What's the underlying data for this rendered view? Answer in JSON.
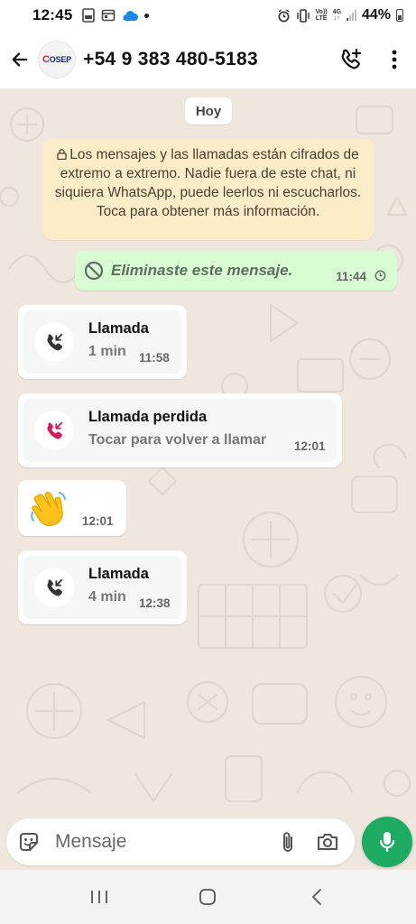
{
  "status_bar": {
    "time": "12:45",
    "network_volte": "Vo))",
    "network_lte": "LTE",
    "network_4g": "4G",
    "battery": "44%"
  },
  "header": {
    "avatar_text": "COSEP",
    "contact": "+54 9 383 480-5183",
    "icons": [
      "back-arrow-icon",
      "add-call-icon",
      "more-vert-icon"
    ]
  },
  "chat": {
    "date_chip": "Hoy",
    "e2e_notice": "Los mensajes y las llamadas están cifrados de extremo a extremo. Nadie fuera de este chat, ni siquiera WhatsApp, puede leerlos ni escucharlos. Toca para obtener más información.",
    "deleted": {
      "text": "Eliminaste este mensaje.",
      "time": "11:44"
    },
    "calls": [
      {
        "title": "Llamada",
        "subtitle": "1 min",
        "time": "11:58",
        "type": "incoming"
      },
      {
        "title": "Llamada perdida",
        "subtitle": "Tocar para volver a llamar",
        "time": "12:01",
        "type": "missed"
      },
      {
        "title": "Llamada",
        "subtitle": "4 min",
        "time": "12:38",
        "type": "incoming"
      }
    ],
    "wave": {
      "emoji": "waving-hand",
      "time": "12:01"
    }
  },
  "composer": {
    "placeholder": "Mensaje"
  },
  "colors": {
    "chat_background": "#efe7de",
    "outgoing_bubble": "#d9fdd3",
    "notice_background": "#fdecc8",
    "missed_call": "#d81b60",
    "accent_green": "#1daa61"
  }
}
